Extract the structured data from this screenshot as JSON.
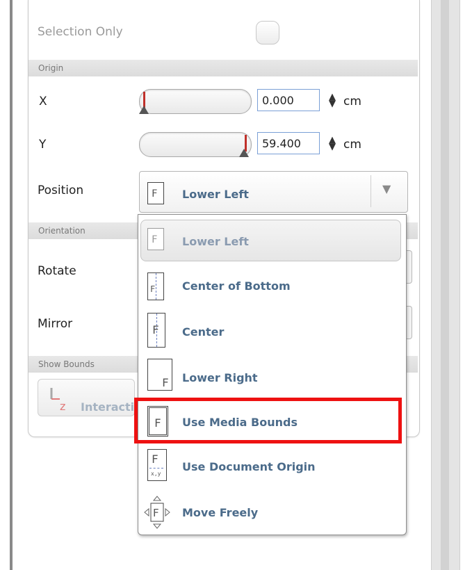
{
  "panel": {
    "selection_only_label": "Selection Only",
    "section_origin": "Origin",
    "x_label": "X",
    "x_value": "0.000",
    "y_label": "Y",
    "y_value": "59.400",
    "unit": "cm",
    "position_label": "Position",
    "section_orientation": "Orientation",
    "rotate_label": "Rotate",
    "mirror_label": "Mirror",
    "section_show_bounds": "Show Bounds",
    "interactive_label": "Interacti"
  },
  "position_combo": {
    "selected": "Lower Left"
  },
  "position_options": [
    {
      "label": "Lower Left",
      "icon": "position-lower-left-icon"
    },
    {
      "label": "Center of Bottom",
      "icon": "position-center-of-bottom-icon"
    },
    {
      "label": "Center",
      "icon": "position-center-icon"
    },
    {
      "label": "Lower Right",
      "icon": "position-lower-right-icon"
    },
    {
      "label": "Use Media Bounds",
      "icon": "use-media-bounds-icon"
    },
    {
      "label": "Use Document Origin",
      "icon": "use-document-origin-icon"
    },
    {
      "label": "Move Freely",
      "icon": "move-freely-icon"
    }
  ],
  "colors": {
    "highlight": "#ee1111",
    "option_text": "#4b6b8a",
    "slider_marker": "#c0302a"
  }
}
